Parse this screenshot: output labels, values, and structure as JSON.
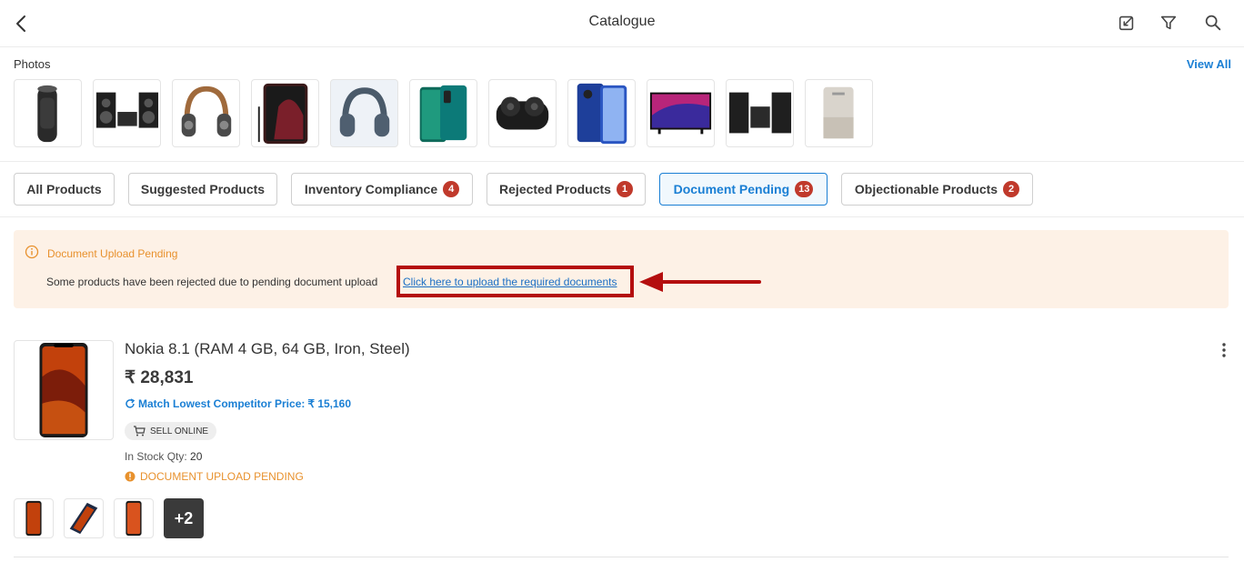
{
  "header": {
    "title": "Catalogue",
    "icons": [
      "back-arrow-icon",
      "edit-icon",
      "filter-icon",
      "search-icon"
    ]
  },
  "photos": {
    "label": "Photos",
    "view_all": "View All",
    "items": [
      "air-purifier",
      "speaker-system",
      "headphones",
      "smartphone",
      "headphones",
      "smartphone",
      "earbuds",
      "smartphone",
      "tv",
      "speaker-system",
      "air-purifier"
    ]
  },
  "tabs": [
    {
      "label": "All Products",
      "badge": ""
    },
    {
      "label": "Suggested Products",
      "badge": ""
    },
    {
      "label": "Inventory Compliance",
      "badge": "4"
    },
    {
      "label": "Rejected Products",
      "badge": "1"
    },
    {
      "label": "Document Pending",
      "badge": "13"
    },
    {
      "label": "Objectionable Products",
      "badge": "2"
    }
  ],
  "active_tab": "Document Pending",
  "alert": {
    "title": "Document Upload Pending",
    "message": "Some products have been rejected due to pending document upload",
    "link": "Click here to upload the required documents"
  },
  "product": {
    "name": "Nokia 8.1 (RAM 4 GB, 64 GB, Iron, Steel)",
    "price": "₹ 28,831",
    "match_label": "Match Lowest Competitor Price:",
    "match_price": "₹ 15,160",
    "sell_online": "SELL ONLINE",
    "stock_label": "In Stock Qty:",
    "stock_value": "20",
    "status": "DOCUMENT UPLOAD PENDING",
    "more_images": "+2"
  },
  "colors": {
    "accent": "#1a7fd4",
    "badge": "#c0392b",
    "warning": "#e8912d",
    "alert_bg": "#fdf1e6",
    "annotation": "#b40e0e"
  }
}
